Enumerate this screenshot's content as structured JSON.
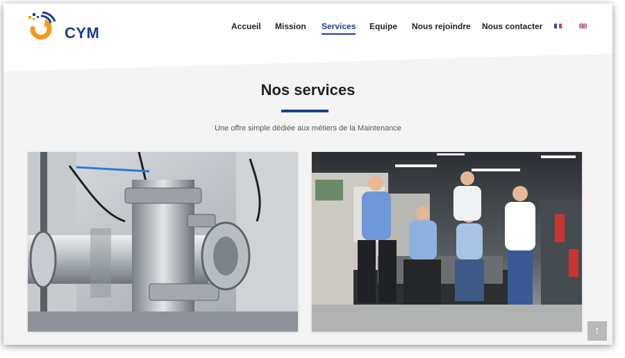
{
  "brand": {
    "name": "CYM"
  },
  "nav": {
    "items": [
      {
        "label": "Accueil"
      },
      {
        "label": "Mission"
      },
      {
        "label": "Services"
      },
      {
        "label": "Equipe"
      },
      {
        "label": "Nous rejoindre"
      },
      {
        "label": "Nous contacter"
      }
    ],
    "active": "Services",
    "languages": [
      {
        "code": "fr"
      },
      {
        "code": "en"
      }
    ]
  },
  "main": {
    "title": "Nos services",
    "subtitle": "Une offre simple dédiée aux métiers de la Maintenance",
    "cards": [
      {
        "image": "industrial-vacuum-pipes-photo"
      },
      {
        "image": "team-photo"
      }
    ]
  },
  "colors": {
    "accent": "#1a3f91",
    "logo_orange": "#f29a1f"
  },
  "icons": {
    "scroll_top": "arrow-up-icon"
  }
}
